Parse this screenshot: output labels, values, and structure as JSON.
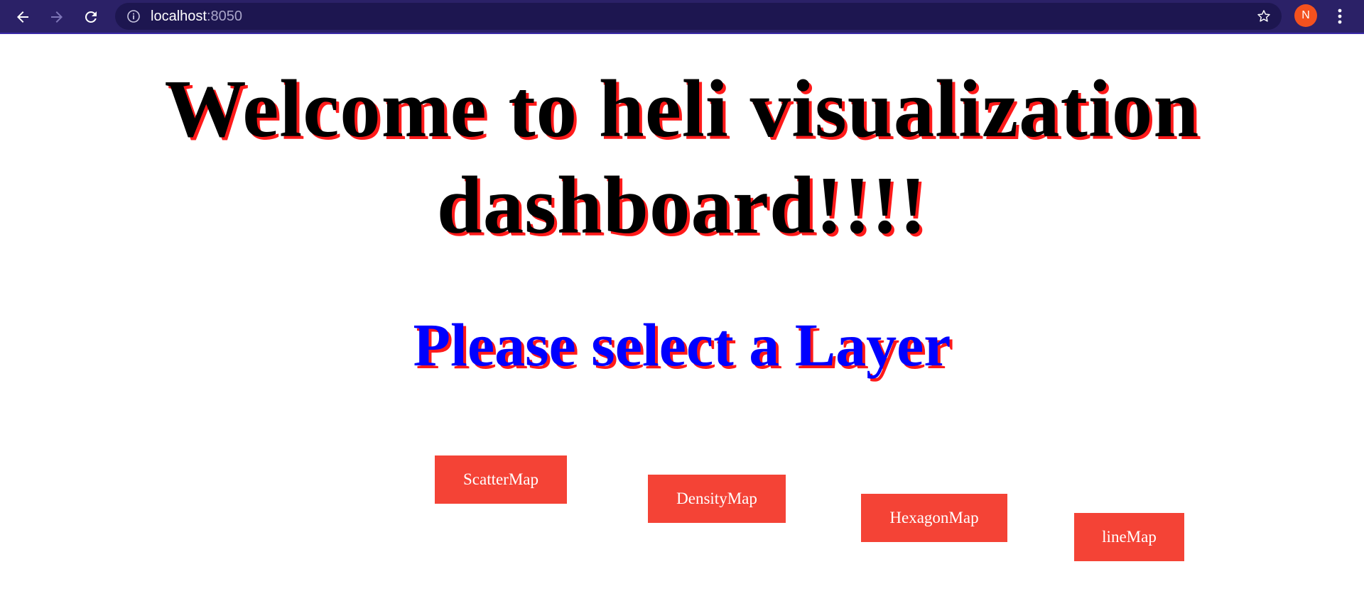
{
  "browser": {
    "url_host": "localhost",
    "url_port": ":8050",
    "profile_initial": "N",
    "profile_color": "#f4511e",
    "toolbar_color": "#2b2167",
    "icons": [
      "back-arrow-icon",
      "forward-arrow-icon",
      "reload-icon",
      "info-icon",
      "star-icon",
      "kebab-menu-icon"
    ]
  },
  "page": {
    "title": "Welcome to heli visualization dashboard!!!!",
    "subtitle": "Please select a Layer",
    "title_color": "#000000",
    "subtitle_color": "#0000ff",
    "shadow_color": "#ff1a1a",
    "button_color": "#f44336",
    "buttons": [
      {
        "label": "ScatterMap"
      },
      {
        "label": "DensityMap"
      },
      {
        "label": "HexagonMap"
      },
      {
        "label": "lineMap"
      }
    ]
  }
}
